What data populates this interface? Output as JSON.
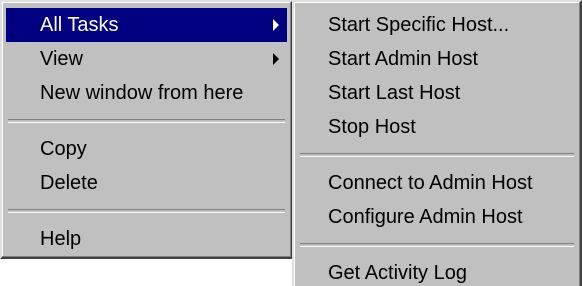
{
  "main_menu": {
    "items": [
      {
        "label": "All Tasks",
        "has_submenu": true,
        "selected": true
      },
      {
        "label": "View",
        "has_submenu": true
      },
      {
        "label": "New window from here"
      },
      {
        "label": "Copy"
      },
      {
        "label": "Delete"
      },
      {
        "label": "Help"
      }
    ]
  },
  "sub_menu": {
    "items": [
      {
        "label": "Start Specific Host..."
      },
      {
        "label": "Start Admin Host"
      },
      {
        "label": "Start Last Host"
      },
      {
        "label": "Stop Host"
      },
      {
        "label": "Connect to Admin Host"
      },
      {
        "label": "Configure Admin Host"
      },
      {
        "label": "Get Activity Log"
      }
    ]
  },
  "colors": {
    "menu_bg": "#c0c0c0",
    "selection_bg": "#000080",
    "selection_text": "#ffffff",
    "text": "#000000"
  }
}
